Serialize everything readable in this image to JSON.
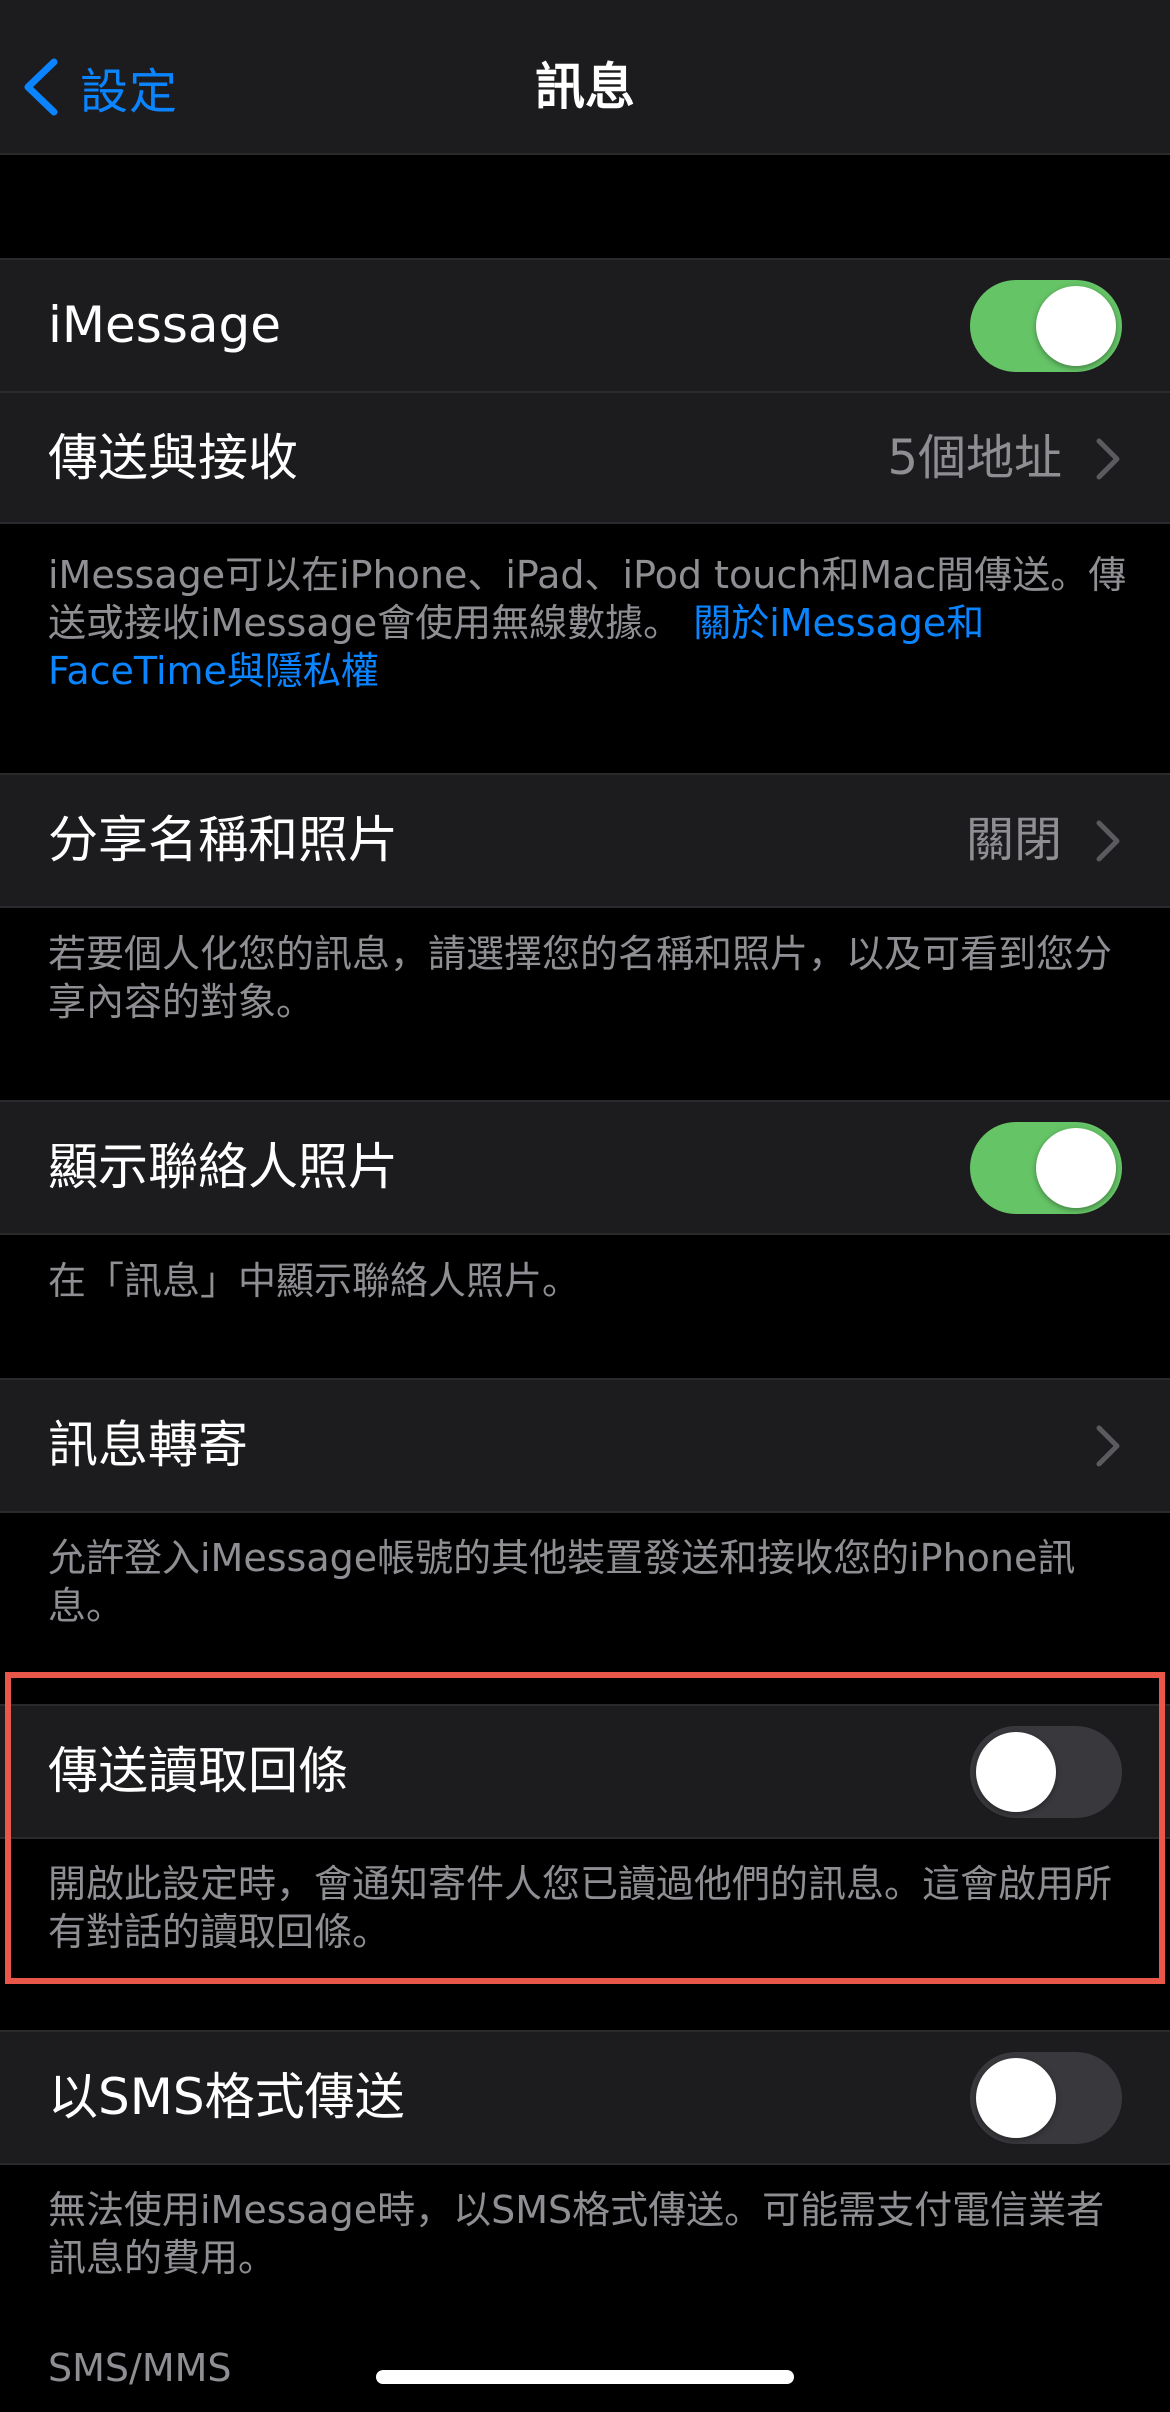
{
  "nav": {
    "back_label": "設定",
    "title": "訊息"
  },
  "imessage": {
    "label": "iMessage",
    "toggle": "on"
  },
  "send_receive": {
    "label": "傳送與接收",
    "value": "5個地址"
  },
  "imessage_footer": {
    "text": "iMessage可以在iPhone、iPad、iPod touch和Mac間傳送。傳送或接收iMessage會使用無線數據。",
    "link": "關於iMessage和FaceTime與隱私權"
  },
  "share_name_photo": {
    "label": "分享名稱和照片",
    "value": "關閉",
    "footer": "若要個人化您的訊息，請選擇您的名稱和照片，以及可看到您分享內容的對象。"
  },
  "show_contact_photos": {
    "label": "顯示聯絡人照片",
    "toggle": "on",
    "footer": "在「訊息」中顯示聯絡人照片。"
  },
  "text_forwarding": {
    "label": "訊息轉寄",
    "footer": "允許登入iMessage帳號的其他裝置發送和接收您的iPhone訊息。"
  },
  "read_receipts": {
    "label": "傳送讀取回條",
    "toggle": "off",
    "footer": "開啟此設定時，會通知寄件人您已讀過他們的訊息。這會啟用所有對話的讀取回條。"
  },
  "send_as_sms": {
    "label": "以SMS格式傳送",
    "toggle": "off",
    "footer": "無法使用iMessage時，以SMS格式傳送。可能需支付電信業者訊息的費用。"
  },
  "sms_section_header": "SMS/MMS",
  "colors": {
    "accent": "#0a84ff",
    "toggle_on": "#65c466",
    "toggle_off": "#39393d",
    "highlight": "#e9574a",
    "background": "#000000",
    "cell": "#1c1c1e"
  },
  "icons": {
    "back": "chevron-left-icon",
    "disclosure": "chevron-right-icon"
  }
}
